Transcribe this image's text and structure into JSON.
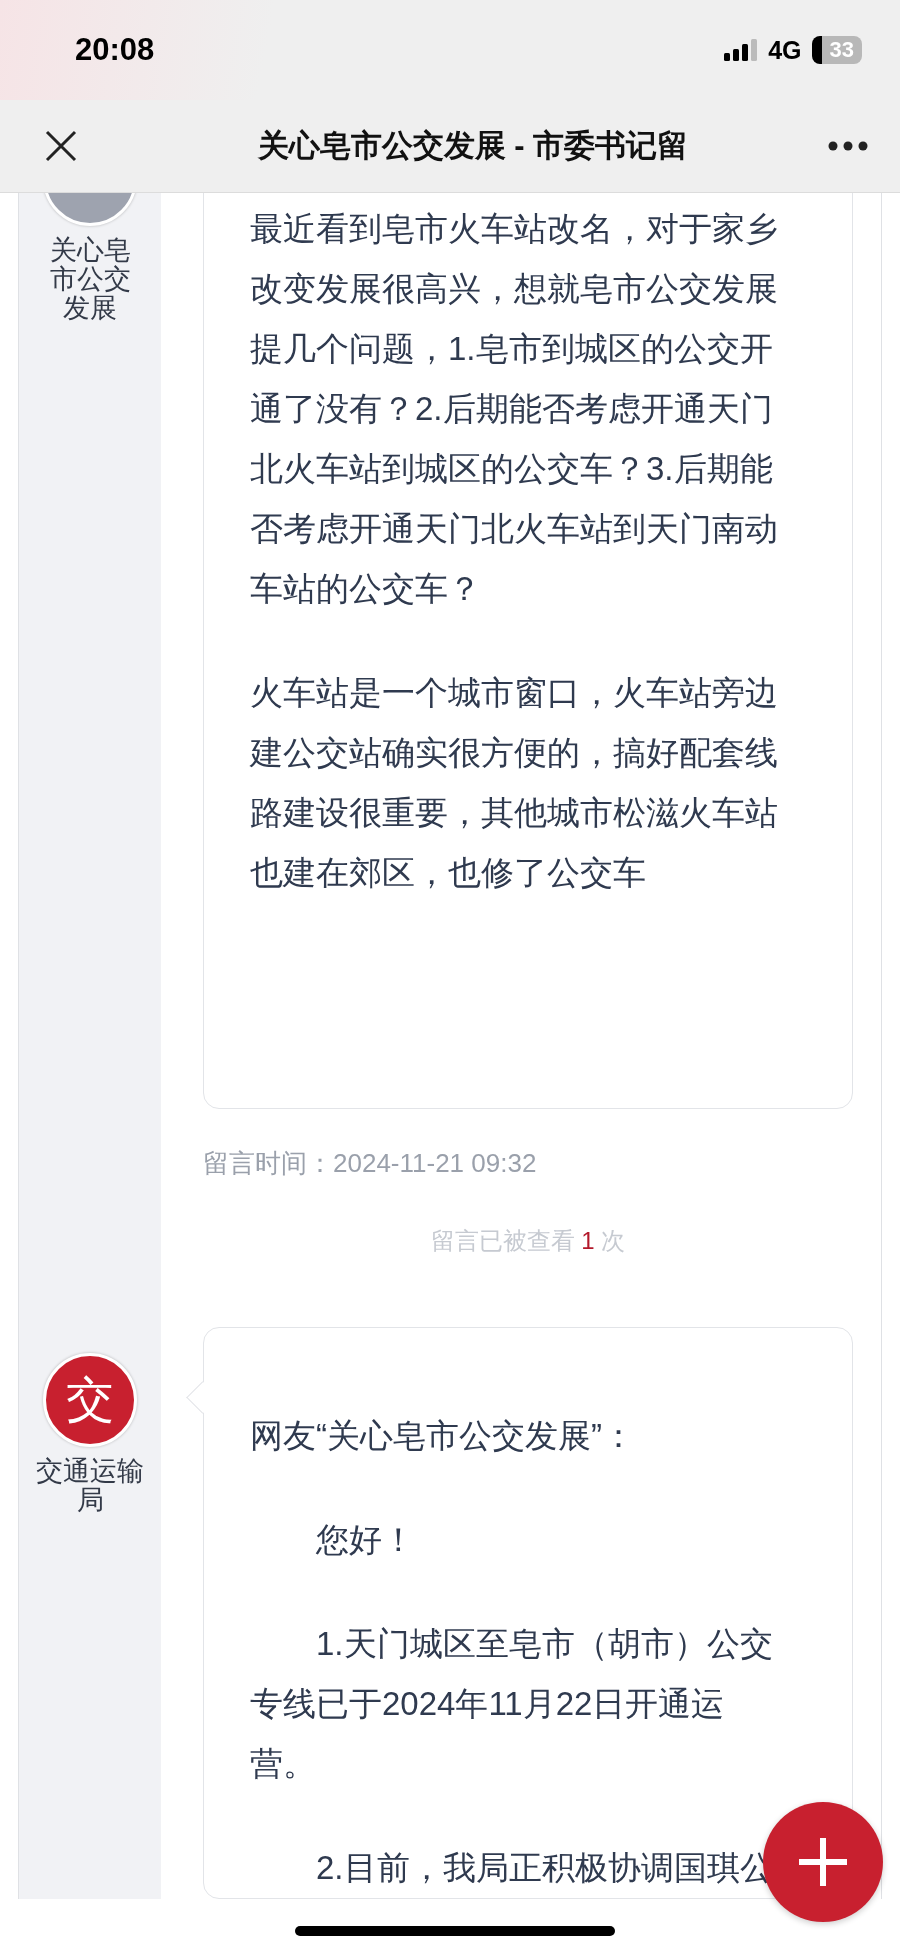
{
  "status_bar": {
    "time": "20:08",
    "network": "4G",
    "battery": "33"
  },
  "nav": {
    "title": "关心皂市公交发展 - 市委书记留"
  },
  "messages": [
    {
      "kind": "question",
      "author": "关心皂市公交发展",
      "paragraphs": [
        {
          "text": "最近看到皂市火车站改名，对于家乡改变发展很高兴，想就皂市公交发展提几个问题，1.皂市到城区的公交开通了没有？2.后期能否考虑开通天门北火车站到城区的公交车？3.后期能否考虑开通天门北火车站到天门南动车站的公交车？",
          "indent": false
        },
        {
          "text": "火车站是一个城市窗口，火车站旁边建公交站确实很方便的，搞好配套线路建设很重要，其他城市松滋火车站也建在郊区，也修了公交车",
          "indent": false
        }
      ],
      "time": "留言时间：2024-11-21 09:32",
      "views_before": "留言已被查看",
      "views": "1",
      "views_after": "次"
    },
    {
      "kind": "reply",
      "author": "交通运输局",
      "avatar": "交",
      "paragraphs": [
        {
          "text": "网友“关心皂市公交发展”：",
          "indent": false
        },
        {
          "text": "您好！",
          "indent": true
        },
        {
          "text": "1.天门城区至皂市（胡市）公交专线已于2024年11月22日开通运营。",
          "indent": true
        },
        {
          "text": "2.目前，我局正积极协调国琪公",
          "indent": true
        }
      ]
    }
  ]
}
